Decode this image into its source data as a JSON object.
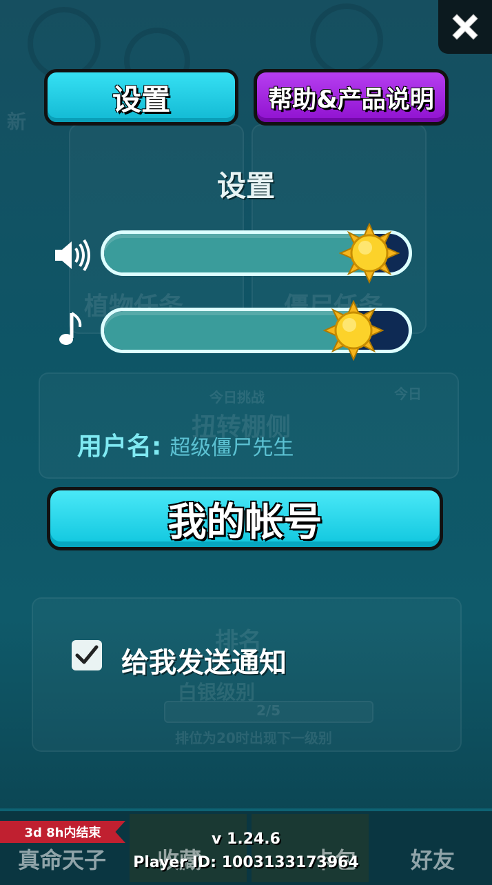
{
  "window": {
    "close_icon": "close-icon"
  },
  "tabs": [
    {
      "label": "设置",
      "active": true,
      "color": "#12b9d3"
    },
    {
      "label": "帮助&产品说明",
      "active": false,
      "color": "#8f11cf"
    }
  ],
  "settings": {
    "title": "设置",
    "sound_volume": {
      "icon": "speaker-icon",
      "level": 0.87
    },
    "music_volume": {
      "icon": "music-note-icon",
      "level": 0.82
    },
    "username_label": "用户名:",
    "username_value": "超级僵尸先生",
    "account_button": "我的帐号",
    "notifications": {
      "label": "给我发送通知",
      "checked": true
    }
  },
  "background": {
    "top_left_text": "新",
    "plant_quest": "植物任务",
    "zombie_quest": "僵尸任务",
    "daily_challenge": "今日挑战",
    "daily_title": "扭转棚侧",
    "today": "今日",
    "rank_title": "排名",
    "rank_subtitle": "白银级别",
    "rank_progress": "2/5",
    "rank_hint": "排位为20时出现下一级别"
  },
  "footer": {
    "event_timer": "3d 8h内结束",
    "left_tab": "真命天子",
    "collection_tab": "收藏",
    "packs_tab": "卡包",
    "friends_tab": "好友",
    "version": "v 1.24.6",
    "player_id": "Player ID: 1003133173964"
  }
}
